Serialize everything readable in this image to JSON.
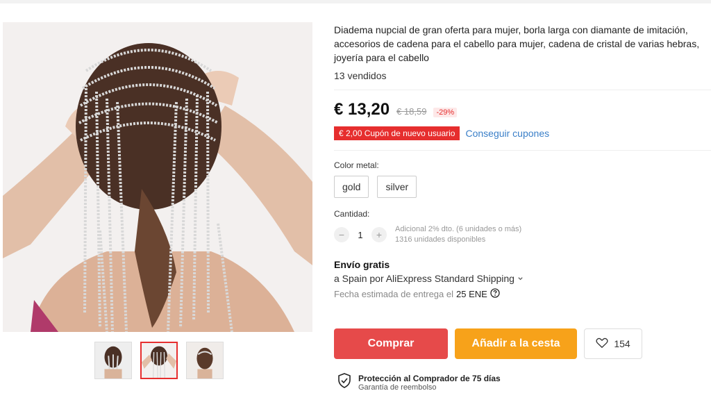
{
  "product": {
    "title": "Diadema nupcial de gran oferta para mujer, borla larga con diamante de imitación, accesorios de cadena para el cabello para mujer, cadena de cristal de varias hebras, joyería para el cabello",
    "sold": "13 vendidos",
    "price": "€ 13,20",
    "old_price": "€ 18,59",
    "discount": "-29%",
    "coupon": "€ 2,00 Cupón de nuevo usuario",
    "get_coupons": "Conseguir cupones"
  },
  "color": {
    "label": "Color metal:",
    "options": [
      "gold",
      "silver"
    ]
  },
  "quantity": {
    "label": "Cantidad:",
    "minus": "−",
    "value": "1",
    "plus": "+",
    "extra_discount": "Adicional 2% dto. (6 unidades o más)",
    "available": "1316 unidades disponibles"
  },
  "shipping": {
    "title": "Envío gratis",
    "line": "a Spain por AliExpress Standard Shipping",
    "eta_label": "Fecha estimada de entrega el",
    "eta_date": "25 ENE"
  },
  "actions": {
    "buy": "Comprar",
    "add_to_cart": "Añadir a la cesta",
    "wishlist_count": "154"
  },
  "protection": {
    "title": "Protección al Comprador de 75 días",
    "subtitle": "Garantía de reembolso"
  },
  "colors": {
    "accent_red": "#e64a4a",
    "accent_orange": "#f7a21a",
    "link_blue": "#3a7fc8"
  },
  "icons": {
    "wishlist": "heart-icon",
    "dropdown": "chevron-down-icon",
    "help": "question-circle-icon",
    "protection": "shield-check-icon"
  }
}
